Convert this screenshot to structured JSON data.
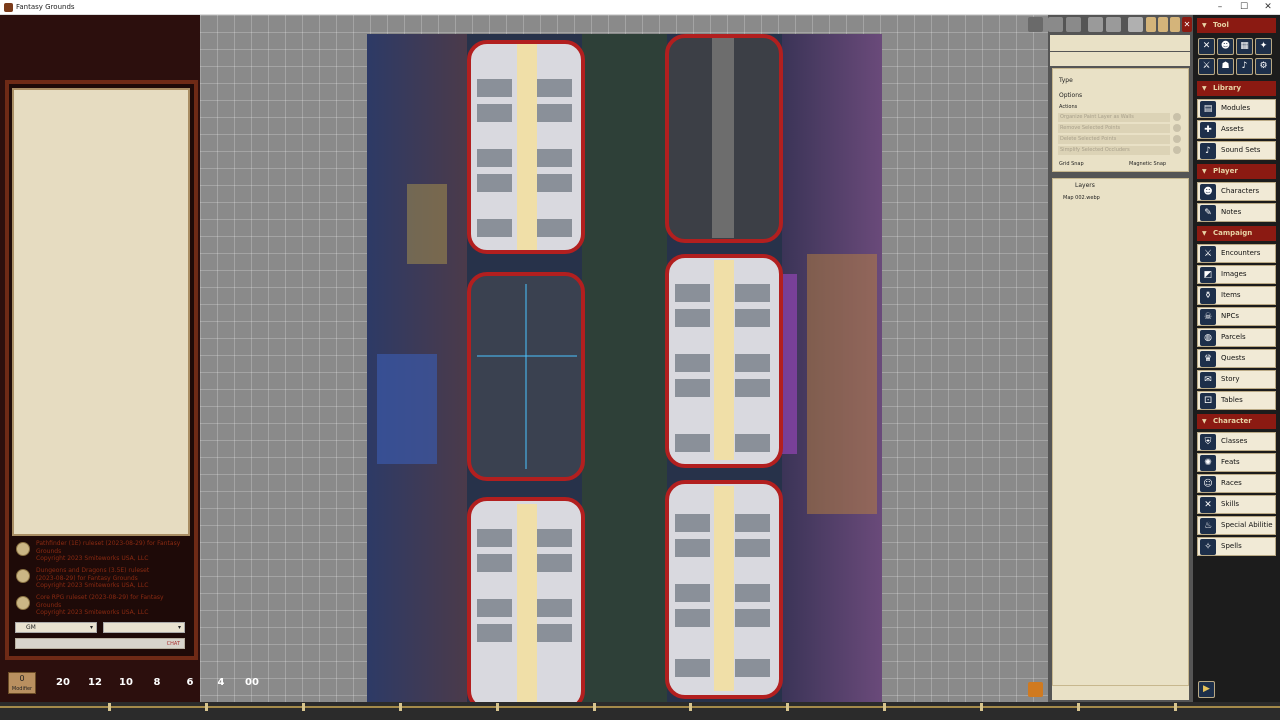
{
  "window": {
    "title": "Fantasy Grounds",
    "controls": [
      "–",
      "☐",
      "✕"
    ]
  },
  "chat": {
    "messages": [
      {
        "line1": "Pathfinder (1E) ruleset (2023-08-29) for Fantasy",
        "line2": "Grounds",
        "line3": "Copyright 2023 Smiteworks USA, LLC"
      },
      {
        "line1": "Dungeons and Dragons (3.5E) ruleset",
        "line2": "(2023-08-29) for Fantasy Grounds",
        "line3": "Copyright 2023 Smiteworks USA, LLC"
      },
      {
        "line1": "Core RPG ruleset (2023-08-29) for Fantasy",
        "line2": "Grounds",
        "line3": "Copyright 2023 Smiteworks USA, LLC"
      }
    ],
    "identity_select": "GM",
    "language_select": "",
    "input_hint": "CHAT"
  },
  "dice": {
    "modifier_value": "0",
    "modifier_label": "Modifier",
    "labels": [
      "20",
      "12",
      "10",
      "8",
      "6",
      "4",
      "00"
    ]
  },
  "tool_panel": {
    "type_label": "Type",
    "options_label": "Options",
    "actions_label": "Actions",
    "actions": [
      "Organize Paint Layer as Walls",
      "Remove Selected Points",
      "Delete Selected Points",
      "Simplify Selected Occluders"
    ],
    "grid_snap_label": "Grid Snap",
    "magnetic_snap_label": "Magnetic Snap"
  },
  "layers_panel": {
    "title": "Layers",
    "items": [
      "Map 002.webp"
    ]
  },
  "sidebar": {
    "sections": [
      {
        "title": "Tool",
        "buttons": []
      },
      {
        "title": "Library",
        "buttons": [
          "Modules",
          "Assets",
          "Sound Sets"
        ]
      },
      {
        "title": "Player",
        "buttons": [
          "Characters",
          "Notes"
        ]
      },
      {
        "title": "Campaign",
        "buttons": [
          "Encounters",
          "Images",
          "Items",
          "NPCs",
          "Parcels",
          "Quests",
          "Story",
          "Tables"
        ]
      },
      {
        "title": "Character",
        "buttons": [
          "Classes",
          "Feats",
          "Races",
          "Skills",
          "Special Abilitie",
          "Spells"
        ]
      }
    ]
  },
  "timeline": {
    "ticks": [
      "1",
      "2",
      "3",
      "4",
      "5",
      "6",
      "7",
      "8",
      "9",
      "10",
      "11",
      "12"
    ]
  },
  "icons": [
    "grid-toggle-icon",
    "lock-icon",
    "pin-icon",
    "close-icon",
    "play-icon",
    "fullscreen-icon"
  ]
}
